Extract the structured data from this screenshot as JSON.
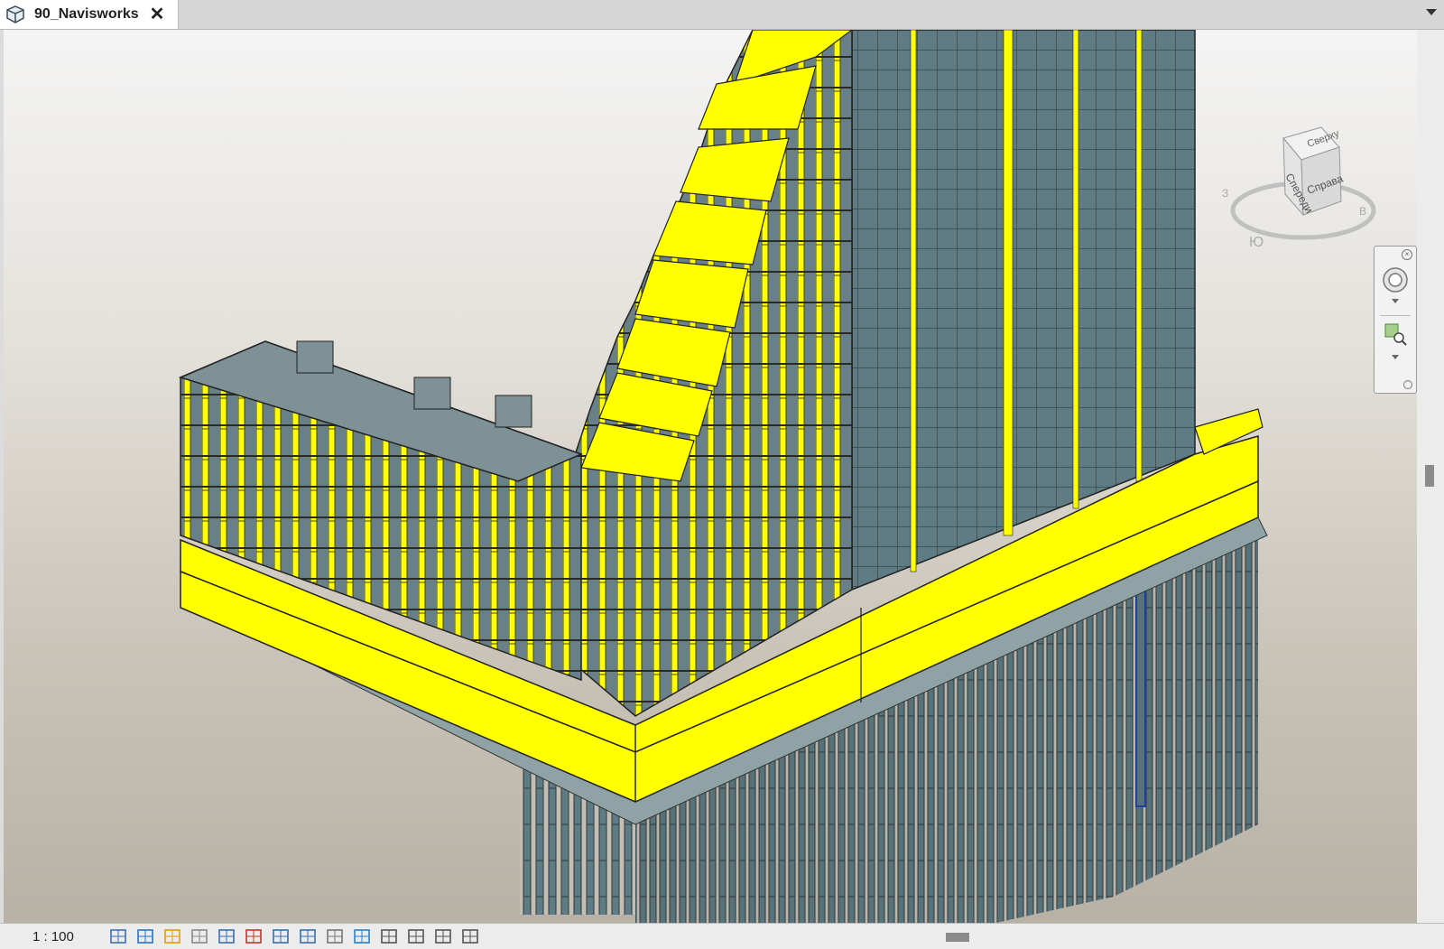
{
  "tab": {
    "title": "90_Navisworks",
    "icon": "3d-view-icon",
    "close_icon": "close-icon"
  },
  "viewcube": {
    "top": "Сверху",
    "front": "Спереди",
    "right": "Справа",
    "south": "Ю",
    "west": "З",
    "east": "В"
  },
  "status": {
    "scale": "1 : 100",
    "icons": [
      "detail-level-icon",
      "visual-style-icon",
      "sun-path-icon",
      "shadows-icon",
      "crop-view-icon",
      "show-crop-region-icon",
      "unlock-3d-view-icon",
      "temporary-hide-isolate-icon",
      "reveal-hidden-elements-icon",
      "temporary-view-properties-icon",
      "analytical-model-icon",
      "highlight-displacement-icon",
      "reveal-constraints-icon",
      "worksharing-display-icon"
    ]
  },
  "colors": {
    "highlight": "#ffff00",
    "steel": "#5f7b84",
    "background_top": "#f4f4f4",
    "background_bottom": "#b7b1a6"
  }
}
